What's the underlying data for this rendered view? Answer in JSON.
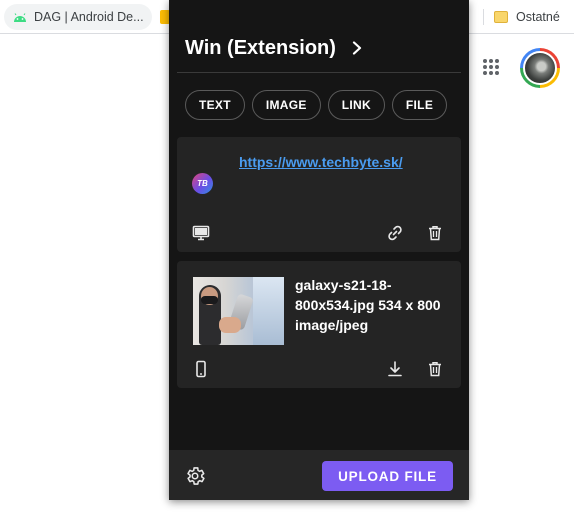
{
  "bookmarks_bar": {
    "tab_label": "DAG | Android De...",
    "folder_label": "Ostatné"
  },
  "popup": {
    "device_title": "Win (Extension)",
    "filters": [
      "TEXT",
      "IMAGE",
      "LINK",
      "FILE"
    ],
    "items": [
      {
        "kind": "link",
        "url": "https://www.techbyte.sk/",
        "favicon_text": "TB",
        "source_icon": "desktop-icon",
        "actions": [
          "link-icon",
          "trash-icon"
        ]
      },
      {
        "kind": "image",
        "file_info": "galaxy-s21-18-800x534.jpg 534 x 800 image/jpeg",
        "source_icon": "smartphone-icon",
        "actions": [
          "download-icon",
          "trash-icon"
        ]
      }
    ],
    "footer": {
      "upload_label": "UPLOAD FILE"
    }
  },
  "colors": {
    "popup_bg": "#151515",
    "card_bg": "#242424",
    "accent": "#7c5cf2",
    "link": "#4a9cf0"
  }
}
